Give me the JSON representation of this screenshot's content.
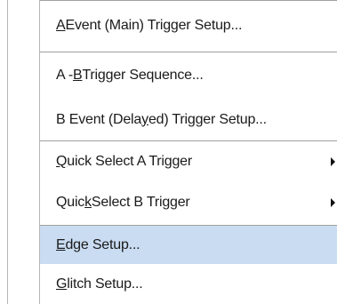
{
  "menu": {
    "items": [
      {
        "pre": "",
        "mnemonic": "A",
        "post": " Event (Main) Trigger Setup...",
        "submenu": false
      },
      {
        "pre": "A - ",
        "mnemonic": "B",
        "post": " Trigger Sequence...",
        "submenu": false
      },
      {
        "pre": "B Event (Dela",
        "mnemonic": "y",
        "post": "ed) Trigger Setup...",
        "submenu": false
      },
      {
        "pre": "",
        "mnemonic": "Q",
        "post": "uick Select A Trigger",
        "submenu": true
      },
      {
        "pre": "Quic",
        "mnemonic": "k",
        "post": " Select B Trigger",
        "submenu": true
      },
      {
        "pre": "",
        "mnemonic": "E",
        "post": "dge Setup...",
        "submenu": false,
        "highlighted": true
      },
      {
        "pre": "",
        "mnemonic": "G",
        "post": "litch Setup...",
        "submenu": false
      }
    ],
    "highlight_color": "#c9dcf1",
    "separator_color": "#a0a0a0"
  }
}
